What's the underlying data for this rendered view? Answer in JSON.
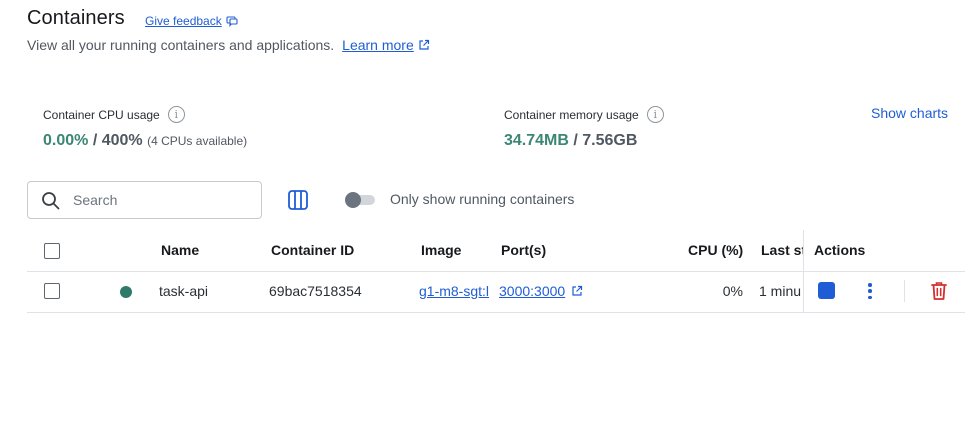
{
  "header": {
    "title": "Containers",
    "feedback_label": "Give feedback",
    "subtitle": "View all your running containers and applications.",
    "learn_more": "Learn more"
  },
  "stats": {
    "cpu": {
      "label": "Container CPU usage",
      "used": "0.00%",
      "separator": " / ",
      "total": "400%",
      "note": "(4 CPUs available)"
    },
    "memory": {
      "label": "Container memory usage",
      "used": "34.74MB",
      "separator": " / ",
      "total": "7.56GB"
    },
    "show_charts": "Show charts"
  },
  "toolbar": {
    "search_placeholder": "Search",
    "toggle_label": "Only show running containers",
    "toggle_on": false
  },
  "table": {
    "headers": {
      "name": "Name",
      "container_id": "Container ID",
      "image": "Image",
      "ports": "Port(s)",
      "cpu": "CPU (%)",
      "last_started": "Last st",
      "actions": "Actions"
    },
    "rows": [
      {
        "status": "running",
        "name": "task-api",
        "container_id": "69bac7518354",
        "image": "g1-m8-sgt:l",
        "ports": "3000:3000",
        "cpu": "0%",
        "last_started": "1 minu"
      }
    ]
  },
  "colors": {
    "accent": "#1f5dd6",
    "running": "#2f7a69",
    "stat_green": "#3b8674",
    "delete": "#d32f2f"
  },
  "icons": {
    "feedback": "feedback-icon",
    "external": "external-link-icon",
    "info": "info-icon",
    "search": "search-icon",
    "columns": "columns-icon",
    "stop": "stop-icon",
    "more": "more-vertical-icon",
    "delete": "trash-icon"
  }
}
